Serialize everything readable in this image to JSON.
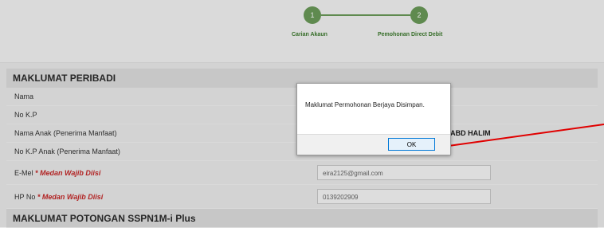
{
  "stepper": {
    "steps": [
      {
        "number": "1",
        "label": "Carian Akaun"
      },
      {
        "number": "2",
        "label": "Pemohonan Direct Debit"
      }
    ]
  },
  "peribadi": {
    "title": "MAKLUMAT PERIBADI",
    "rows": [
      {
        "label": "Nama"
      },
      {
        "label": "No K.P"
      },
      {
        "label": "Nama Anak (Penerima Manfaat)",
        "value": "O ABD HALIM"
      },
      {
        "label": "No K.P Anak (Penerima Manfaat)"
      }
    ],
    "email_label": "E-Mel",
    "email_value": "eira2125@gmail.com",
    "hp_label": "HP No",
    "hp_value": "0139202909",
    "required_marker": "* Medan Wajib Diisi"
  },
  "potongan": {
    "title": "MAKLUMAT POTONGAN SSPN1M-i Plus"
  },
  "dialog": {
    "message": "Maklumat Permohonan Berjaya Disimpan.",
    "ok_label": "OK"
  },
  "colors": {
    "step_green": "#6a9a59",
    "required_red": "#c62828",
    "annotation_red": "#e00000",
    "ok_border": "#0078d7"
  }
}
